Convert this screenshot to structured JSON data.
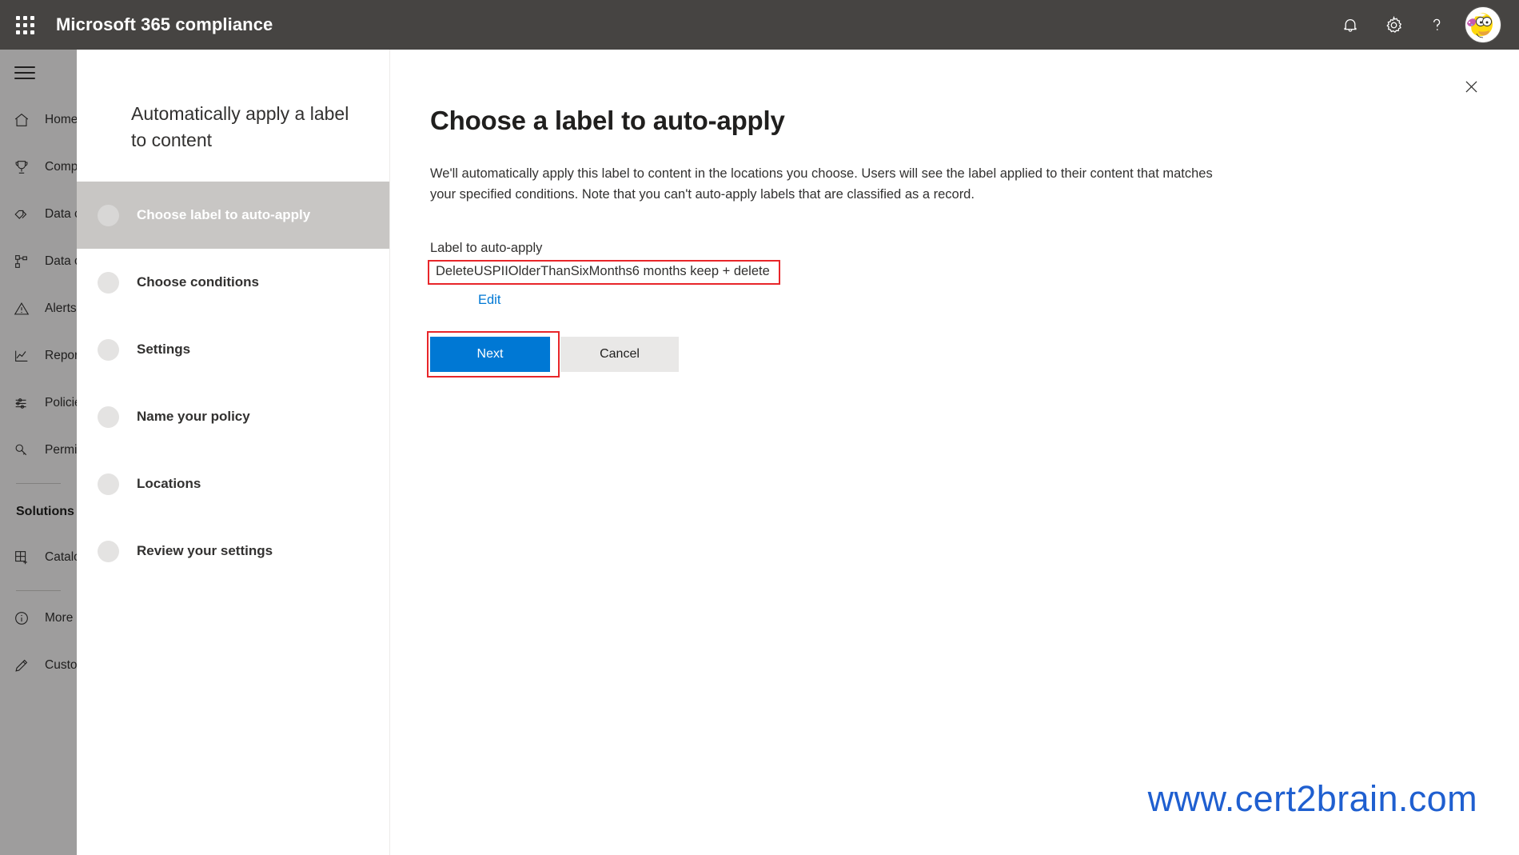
{
  "suite": {
    "title": "Microsoft 365 compliance",
    "waffle_icon": "app-launcher-icon",
    "notifications_icon": "bell-icon",
    "settings_icon": "gear-icon",
    "help_icon": "question-mark-icon",
    "avatar_icon": "user-avatar"
  },
  "left_nav": {
    "hamburger_icon": "hamburger-menu-icon",
    "items": [
      {
        "label": "Home",
        "icon": "home-icon"
      },
      {
        "label": "Compliance manager",
        "icon": "trophy-icon"
      },
      {
        "label": "Data classification",
        "icon": "tag-icon"
      },
      {
        "label": "Data connectors",
        "icon": "sitemap-icon"
      },
      {
        "label": "Alerts",
        "icon": "warning-triangle-icon"
      },
      {
        "label": "Reports",
        "icon": "line-chart-icon"
      },
      {
        "label": "Policies",
        "icon": "sliders-icon"
      },
      {
        "label": "Permissions",
        "icon": "key-icon"
      }
    ],
    "section_title": "Solutions",
    "solutions_items": [
      {
        "label": "Catalog",
        "icon": "catalog-grid-plus-icon"
      }
    ],
    "footer_items": [
      {
        "label": "More resources",
        "icon": "info-circle-icon"
      },
      {
        "label": "Customize navigation",
        "icon": "pencil-icon"
      }
    ]
  },
  "wizard": {
    "heading": "Automatically apply a label to content",
    "steps": [
      {
        "label": "Choose label to auto-apply",
        "active": true
      },
      {
        "label": "Choose conditions",
        "active": false
      },
      {
        "label": "Settings",
        "active": false
      },
      {
        "label": "Name your policy",
        "active": false
      },
      {
        "label": "Locations",
        "active": false
      },
      {
        "label": "Review your settings",
        "active": false
      }
    ]
  },
  "content": {
    "close_icon": "close-x-icon",
    "title": "Choose a label to auto-apply",
    "description": "We'll automatically apply this label to content in the locations you choose. Users will see the label applied to their content that matches your specified conditions. Note that you can't auto-apply labels that are classified as a record.",
    "field_label": "Label to auto-apply",
    "field_value": "DeleteUSPIIOlderThanSixMonths6 months keep + delete",
    "edit_link": "Edit",
    "next_label": "Next",
    "cancel_label": "Cancel"
  },
  "annotations": {
    "highlight_color": "#e8262a",
    "watermark": "www.cert2brain.com"
  },
  "colors": {
    "suite_bar": "#464442",
    "primary_button": "#0078d4",
    "link": "#0078d4",
    "active_step": "#c8c6c4"
  }
}
